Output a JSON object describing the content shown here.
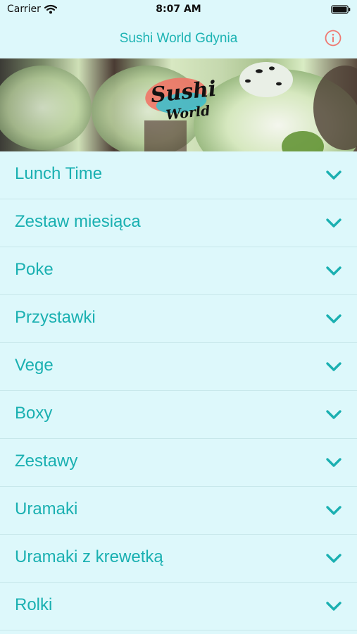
{
  "status_bar": {
    "carrier": "Carrier",
    "time": "8:07 AM",
    "icons": [
      "wifi-icon",
      "battery-icon"
    ]
  },
  "nav": {
    "title": "Sushi World Gdynia",
    "info_icon": "info-icon"
  },
  "hero": {
    "logo_text_top": "Sushi",
    "logo_text_bottom": "World"
  },
  "menu": {
    "items": [
      {
        "label": "Lunch Time",
        "icon": "chevron-down-icon"
      },
      {
        "label": "Zestaw miesiąca",
        "icon": "chevron-down-icon"
      },
      {
        "label": "Poke",
        "icon": "chevron-down-icon"
      },
      {
        "label": "Przystawki",
        "icon": "chevron-down-icon"
      },
      {
        "label": "Vege",
        "icon": "chevron-down-icon"
      },
      {
        "label": "Boxy",
        "icon": "chevron-down-icon"
      },
      {
        "label": "Zestawy",
        "icon": "chevron-down-icon"
      },
      {
        "label": "Uramaki",
        "icon": "chevron-down-icon"
      },
      {
        "label": "Uramaki z krewetką",
        "icon": "chevron-down-icon"
      },
      {
        "label": "Rolki",
        "icon": "chevron-down-icon"
      }
    ]
  },
  "colors": {
    "background": "#ddf8fb",
    "accent": "#1ab0b1",
    "info_icon": "#ef7a73",
    "divider": "#c7e7ea"
  }
}
